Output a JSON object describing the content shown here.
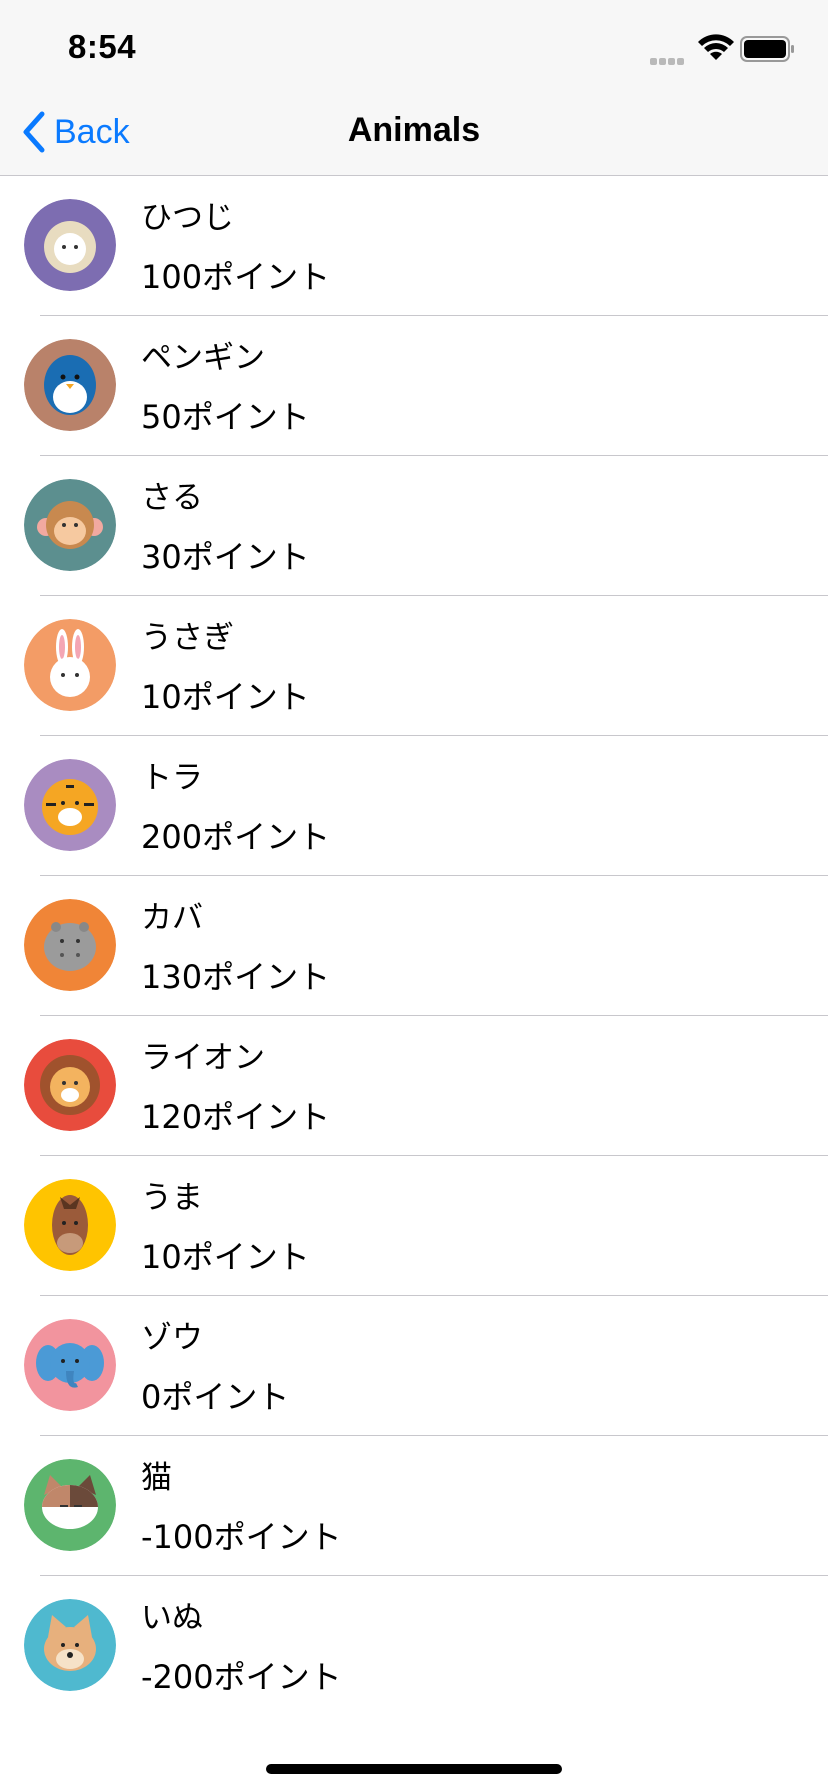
{
  "status_bar": {
    "time": "8:54"
  },
  "nav": {
    "back_label": "Back",
    "title": "Animals"
  },
  "animals": [
    {
      "name": "ひつじ",
      "points": "100ポイント",
      "bg": "#7d6db1",
      "face": "#ffffff",
      "icon": "sheep-icon"
    },
    {
      "name": "ペンギン",
      "points": "50ポイント",
      "bg": "#b9826a",
      "face": "#1a6db3",
      "icon": "penguin-icon"
    },
    {
      "name": "さる",
      "points": "30ポイント",
      "bg": "#5c8f8f",
      "face": "#c8894f",
      "icon": "monkey-icon"
    },
    {
      "name": "うさぎ",
      "points": "10ポイント",
      "bg": "#f39c66",
      "face": "#ffffff",
      "icon": "rabbit-icon"
    },
    {
      "name": "トラ",
      "points": "200ポイント",
      "bg": "#a98cc1",
      "face": "#f5a623",
      "icon": "tiger-icon"
    },
    {
      "name": "カバ",
      "points": "130ポイント",
      "bg": "#f08537",
      "face": "#9b9b9b",
      "icon": "hippo-icon"
    },
    {
      "name": "ライオン",
      "points": "120ポイント",
      "bg": "#e84c3d",
      "face": "#f3b35f",
      "icon": "lion-icon"
    },
    {
      "name": "うま",
      "points": "10ポイント",
      "bg": "#ffc400",
      "face": "#9b5b3a",
      "icon": "horse-icon"
    },
    {
      "name": "ゾウ",
      "points": "0ポイント",
      "bg": "#f2949e",
      "face": "#4b9ad6",
      "icon": "elephant-icon"
    },
    {
      "name": "猫",
      "points": "-100ポイント",
      "bg": "#5db56e",
      "face": "#ffffff",
      "icon": "cat-icon"
    },
    {
      "name": "いぬ",
      "points": "-200ポイント",
      "bg": "#4fb9cf",
      "face": "#e7b07d",
      "icon": "dog-icon"
    }
  ]
}
